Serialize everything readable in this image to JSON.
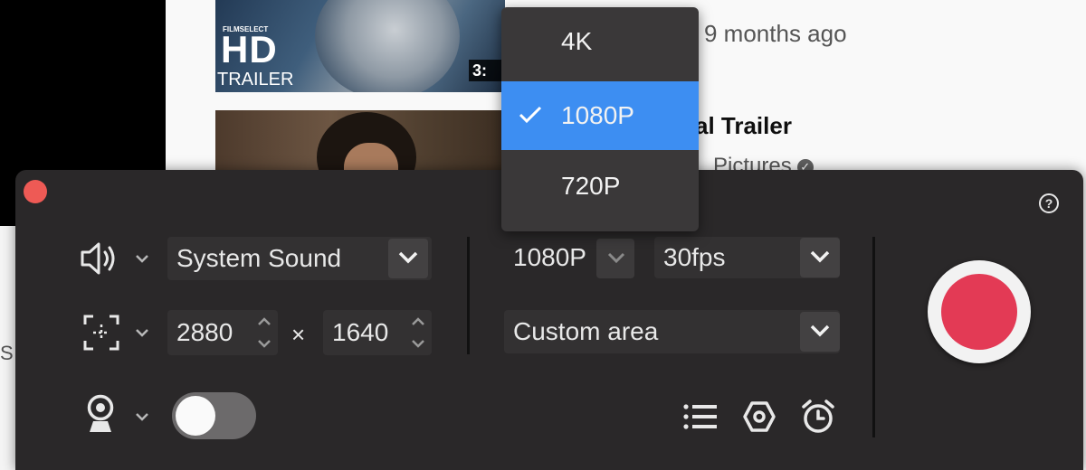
{
  "background_page": {
    "video1": {
      "thumb_badge": "FILMSELECT",
      "thumb_hd": "HD",
      "thumb_trailer": "TRAILER",
      "duration": "3:",
      "age": "9 months ago"
    },
    "video2": {
      "title_fragment": "al Trailer",
      "channel_fragment": "Pictures"
    },
    "left_fragment": "S"
  },
  "recorder": {
    "audio": {
      "icon": "speaker-icon",
      "source": "System Sound"
    },
    "area": {
      "icon": "area-select-icon",
      "width": "2880",
      "times": "×",
      "height": "1640",
      "mode": "Custom area"
    },
    "webcam": {
      "icon": "webcam-icon",
      "enabled": false
    },
    "quality": {
      "resolution": "1080P",
      "fps": "30fps"
    },
    "tools": [
      "list-icon",
      "settings-hexagon-icon",
      "alarm-clock-icon"
    ],
    "help_label": "?",
    "record_color": "#e33a55"
  },
  "resolution_menu": {
    "options": [
      {
        "label": "4K",
        "selected": false
      },
      {
        "label": "1080P",
        "selected": true
      },
      {
        "label": "720P",
        "selected": false
      }
    ],
    "selected_color": "#3d8ef2"
  }
}
